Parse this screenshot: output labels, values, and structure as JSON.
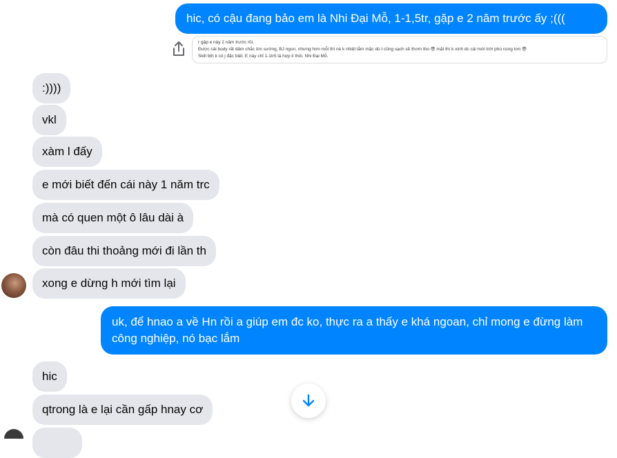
{
  "messages": {
    "out_1": "hic, có cậu đang bảo em là Nhi Đại Mỗ, 1-1,5tr, gặp e 2 năm trước ấy ;(((",
    "quote_lines": [
      "r gặp e này 2 năm trước rồi.",
      "Được cái body rất dâm chắc ôm sướng, BJ ngon, nhưng hơn mỗi thì nè k nhiệt lắm mặc dù t cũng sạch sẽ thơm tho 😎 mặt thì k xinh dc cái mới trời phú cong tơn 😎",
      "Skill bth k có j đặc biệt. E này chỉ 1-1tr5 là hợp lí thôi. Nhi Đại Mỗ."
    ],
    "in_1": ":))))",
    "in_2": "vkl",
    "in_3": "xàm l đấy",
    "in_4": "e mới biết đến cái này 1 năm trc",
    "in_5": "mà có quen một ô lâu dài à",
    "in_6": "còn đâu thi thoảng mới đi lần th",
    "in_7": "xong e dừng h mới tìm lại",
    "out_2": "uk, để hnao a về Hn rồi a giúp em đc ko, thực ra a thấy e khá ngoan, chỉ mong e đừng làm công nghiệp, nó bạc lắm",
    "in_8": "hic",
    "in_9": "qtrong là e lại cần gấp hnay cơ"
  },
  "icons": {
    "share": "share-icon",
    "scroll_down": "arrow-down-icon",
    "avatar": "avatar"
  },
  "colors": {
    "outgoing": "#0084ff",
    "incoming": "#e4e6eb",
    "accent": "#0084ff"
  }
}
